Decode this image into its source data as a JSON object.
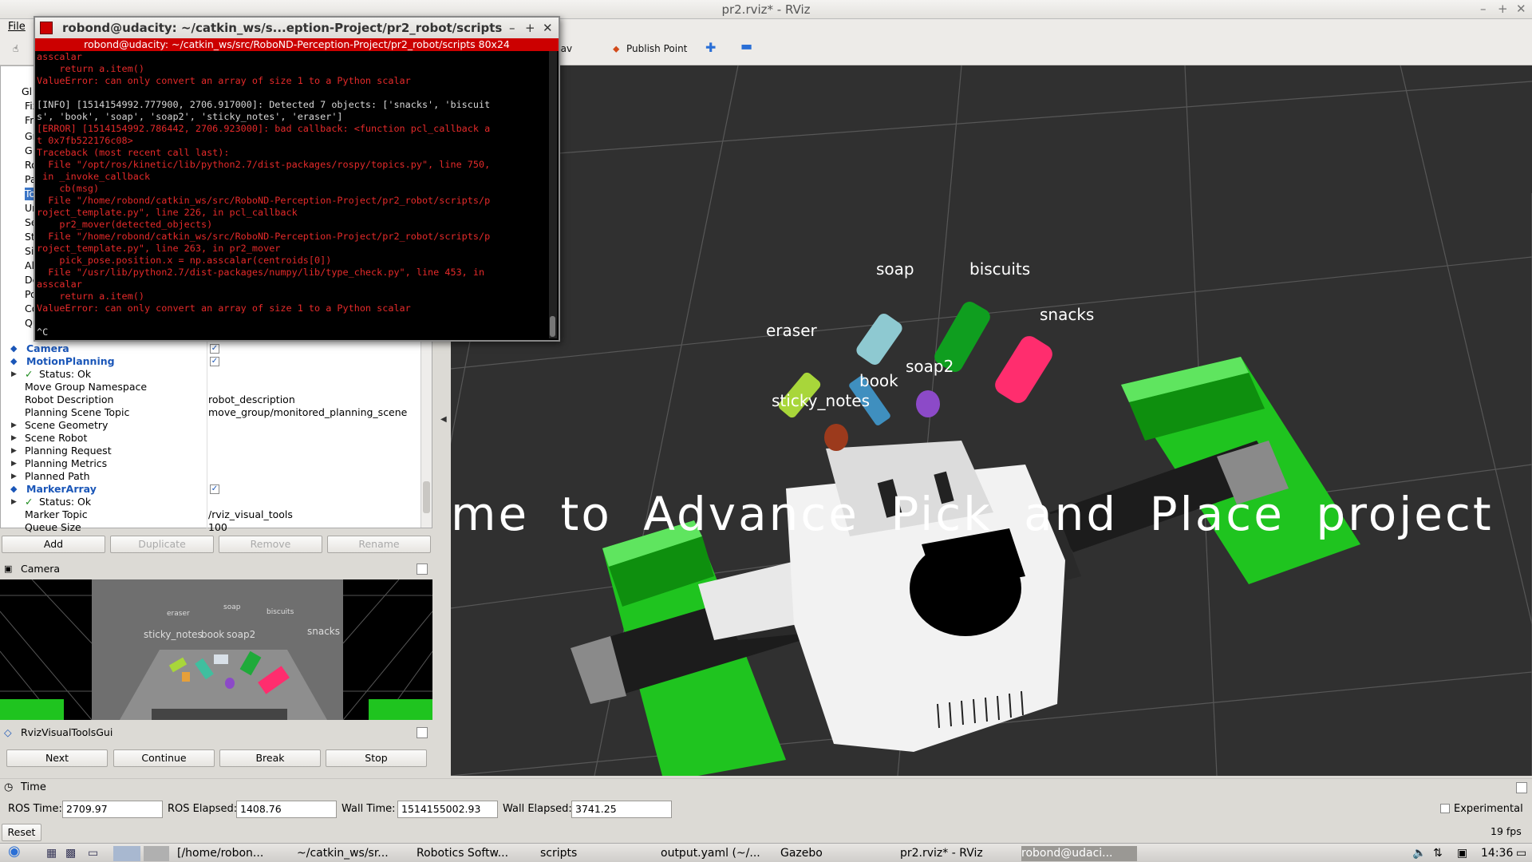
{
  "window": {
    "title": "pr2.rviz* - RViz"
  },
  "menu": {
    "file": "File"
  },
  "toolbar": {
    "nav_goal": "2D Nav Goal",
    "publish_point": "Publish Point"
  },
  "terminal": {
    "title": "robond@udacity: ~/catkin_ws/s...eption-Project/pr2_robot/scripts",
    "tab": "robond@udacity: ~/catkin_ws/src/RoboND-Perception-Project/pr2_robot/scripts 80x24",
    "lines": [
      {
        "text": "asscalar",
        "err": true
      },
      {
        "text": "    return a.item()",
        "err": true
      },
      {
        "text": "ValueError: can only convert an array of size 1 to a Python scalar",
        "err": true
      },
      {
        "text": "",
        "err": false
      },
      {
        "text": "[INFO] [1514154992.777900, 2706.917000]: Detected 7 objects: ['snacks', 'biscuit",
        "err": false
      },
      {
        "text": "s', 'book', 'soap', 'soap2', 'sticky_notes', 'eraser']",
        "err": false
      },
      {
        "text": "[ERROR] [1514154992.786442, 2706.923000]: bad callback: <function pcl_callback a",
        "err": true
      },
      {
        "text": "t 0x7fb522176c08>",
        "err": true
      },
      {
        "text": "Traceback (most recent call last):",
        "err": true
      },
      {
        "text": "  File \"/opt/ros/kinetic/lib/python2.7/dist-packages/rospy/topics.py\", line 750,",
        "err": true
      },
      {
        "text": " in _invoke_callback",
        "err": true
      },
      {
        "text": "    cb(msg)",
        "err": true
      },
      {
        "text": "  File \"/home/robond/catkin_ws/src/RoboND-Perception-Project/pr2_robot/scripts/p",
        "err": true
      },
      {
        "text": "roject_template.py\", line 226, in pcl_callback",
        "err": true
      },
      {
        "text": "    pr2_mover(detected_objects)",
        "err": true
      },
      {
        "text": "  File \"/home/robond/catkin_ws/src/RoboND-Perception-Project/pr2_robot/scripts/p",
        "err": true
      },
      {
        "text": "roject_template.py\", line 263, in pr2_mover",
        "err": true
      },
      {
        "text": "    pick_pose.position.x = np.asscalar(centroids[0])",
        "err": true
      },
      {
        "text": "  File \"/usr/lib/python2.7/dist-packages/numpy/lib/type_check.py\", line 453, in",
        "err": true
      },
      {
        "text": "asscalar",
        "err": true
      },
      {
        "text": "    return a.item()",
        "err": true
      },
      {
        "text": "ValueError: can only convert an array of size 1 to a Python scalar",
        "err": true
      },
      {
        "text": "",
        "err": false
      },
      {
        "text": "^C",
        "err": false
      }
    ]
  },
  "displays": {
    "partial_rows": [
      "Gl",
      "Fix",
      "Fr",
      "Gr",
      "G",
      "Ro",
      "Pa",
      "To",
      "Un",
      "Se",
      "St",
      "Siz",
      "Al",
      "De",
      "Po",
      "Co",
      "Que"
    ],
    "rows": [
      {
        "label": "Camera",
        "kind": "display",
        "checked": true
      },
      {
        "label": "MotionPlanning",
        "kind": "display",
        "checked": true
      },
      {
        "label": "Status: Ok",
        "kind": "status"
      },
      {
        "label": "Move Group Namespace",
        "kind": "prop",
        "value": ""
      },
      {
        "label": "Robot Description",
        "kind": "prop",
        "value": "robot_description"
      },
      {
        "label": "Planning Scene Topic",
        "kind": "prop",
        "value": "move_group/monitored_planning_scene"
      },
      {
        "label": "Scene Geometry",
        "kind": "group"
      },
      {
        "label": "Scene Robot",
        "kind": "group"
      },
      {
        "label": "Planning Request",
        "kind": "group"
      },
      {
        "label": "Planning Metrics",
        "kind": "group"
      },
      {
        "label": "Planned Path",
        "kind": "group"
      },
      {
        "label": "MarkerArray",
        "kind": "display",
        "checked": true
      },
      {
        "label": "Status: Ok",
        "kind": "status"
      },
      {
        "label": "Marker Topic",
        "kind": "prop",
        "value": "/rviz_visual_tools"
      },
      {
        "label": "Queue Size",
        "kind": "prop",
        "value": "100"
      }
    ],
    "buttons": {
      "add": "Add",
      "duplicate": "Duplicate",
      "remove": "Remove",
      "rename": "Rename"
    }
  },
  "camera_panel": {
    "title": "Camera",
    "labels": [
      "eraser",
      "soap",
      "biscuits",
      "sticky_notes",
      "book",
      "soap2",
      "snacks"
    ]
  },
  "rviz_visual_tools": {
    "title": "RvizVisualToolsGui",
    "buttons": {
      "next": "Next",
      "continue": "Continue",
      "break": "Break",
      "stop": "Stop"
    }
  },
  "viewport": {
    "labels": {
      "soap": "soap",
      "biscuits": "biscuits",
      "snacks": "snacks",
      "eraser": "eraser",
      "book": "book",
      "soap2": "soap2",
      "sticky_notes": "sticky_notes"
    },
    "banner": "me to Advance Pick and Place project",
    "colors": {
      "background": "#303030",
      "bin": "#1fc41f",
      "snacks": "#ff2d6e",
      "biscuits": "#0f9e1f",
      "soap": "#8ec9d1",
      "eraser": "#a8d63a",
      "book": "#3f8fbf",
      "soap2": "#8c4ac8",
      "sticky_notes": "#9c3a1c"
    }
  },
  "time": {
    "title": "Time",
    "ros_time_label": "ROS Time:",
    "ros_time": "2709.97",
    "ros_elapsed_label": "ROS Elapsed:",
    "ros_elapsed": "1408.76",
    "wall_time_label": "Wall Time:",
    "wall_time": "1514155002.93",
    "wall_elapsed_label": "Wall Elapsed:",
    "wall_elapsed": "3741.25",
    "experimental": "Experimental",
    "reset": "Reset",
    "fps": "19 fps"
  },
  "taskbar": {
    "items": [
      "[/home/robon...",
      "~/catkin_ws/sr...",
      "Robotics Softw...",
      "scripts",
      "output.yaml (~/...",
      "Gazebo",
      "pr2.rviz* - RViz",
      "robond@udaci..."
    ],
    "clock": "14:36"
  }
}
